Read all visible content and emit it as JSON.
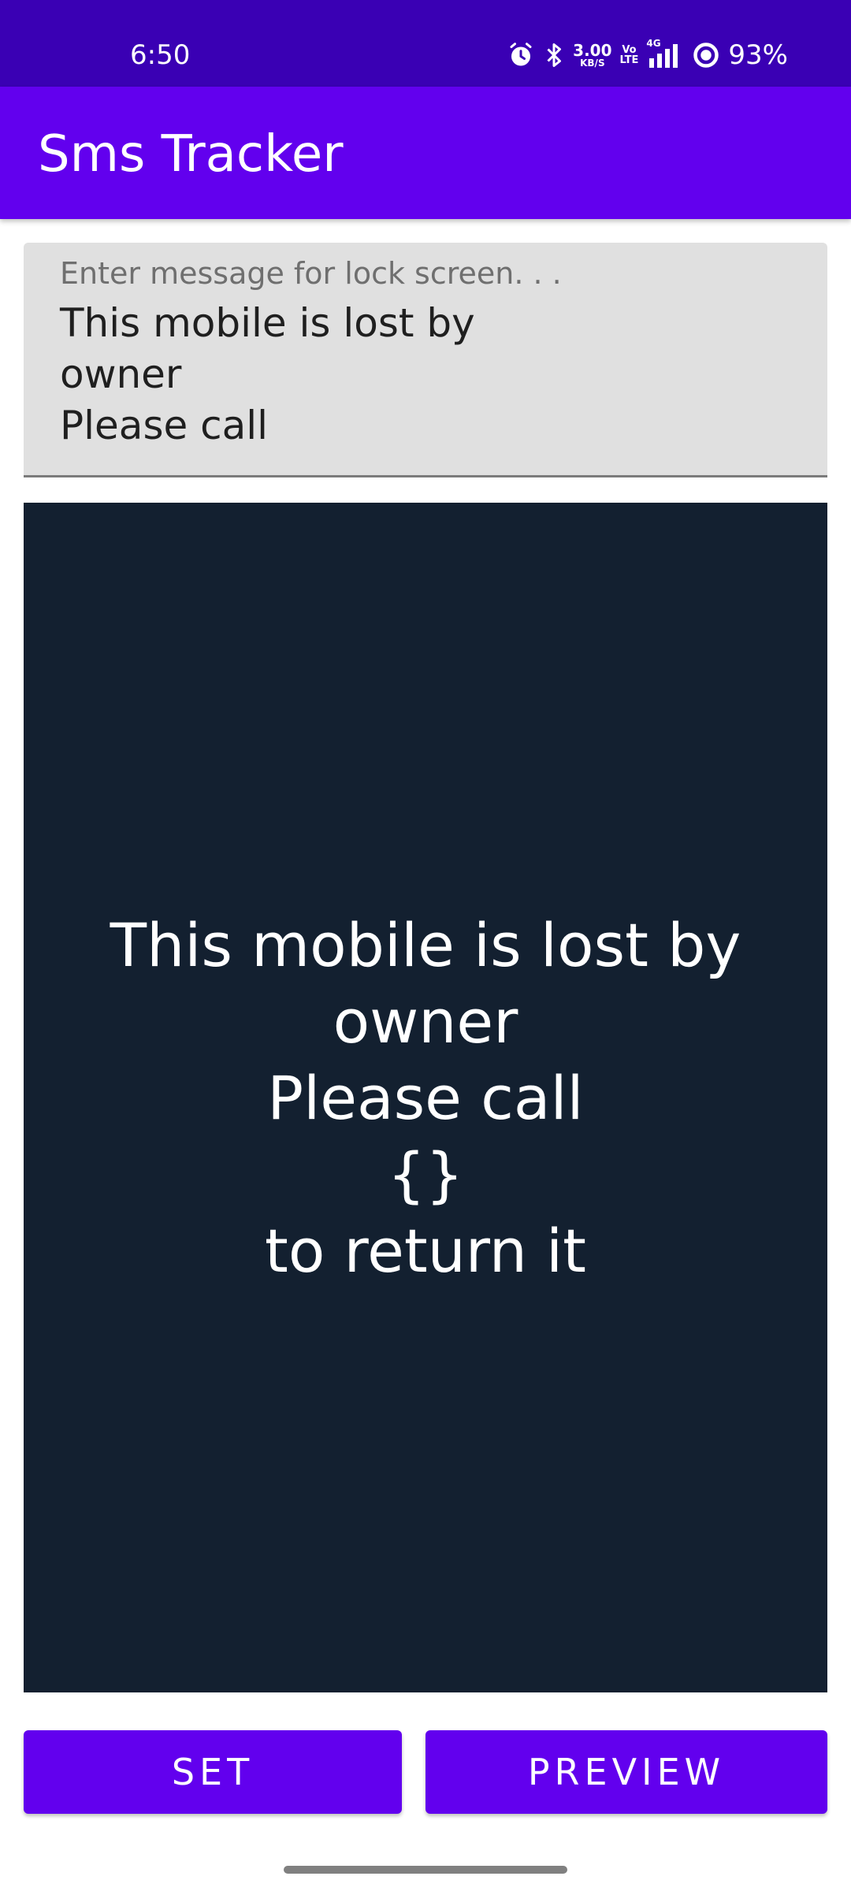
{
  "status_bar": {
    "time": "6:50",
    "net_speed_value": "3.00",
    "net_speed_unit": "KB/S",
    "volte_top": "Vo",
    "volte_bottom": "LTE",
    "network": "4G",
    "battery": "93%",
    "icons": [
      "alarm-icon",
      "bluetooth-icon",
      "signal-icon",
      "battery-icon"
    ]
  },
  "app_bar": {
    "title": "Sms Tracker"
  },
  "message_field": {
    "label": "Enter message for lock screen. . .",
    "value": "This mobile is lost by\nowner\nPlease call"
  },
  "preview": {
    "text": "This mobile is lost by\nowner\nPlease call\n{}\n to return it"
  },
  "buttons": {
    "set_label": "SET",
    "preview_label": "PREVIEW"
  },
  "colors": {
    "status_bar": "#3a00b4",
    "primary": "#6200ee",
    "preview_background": "#132030",
    "field_background": "#e0e0e0"
  }
}
